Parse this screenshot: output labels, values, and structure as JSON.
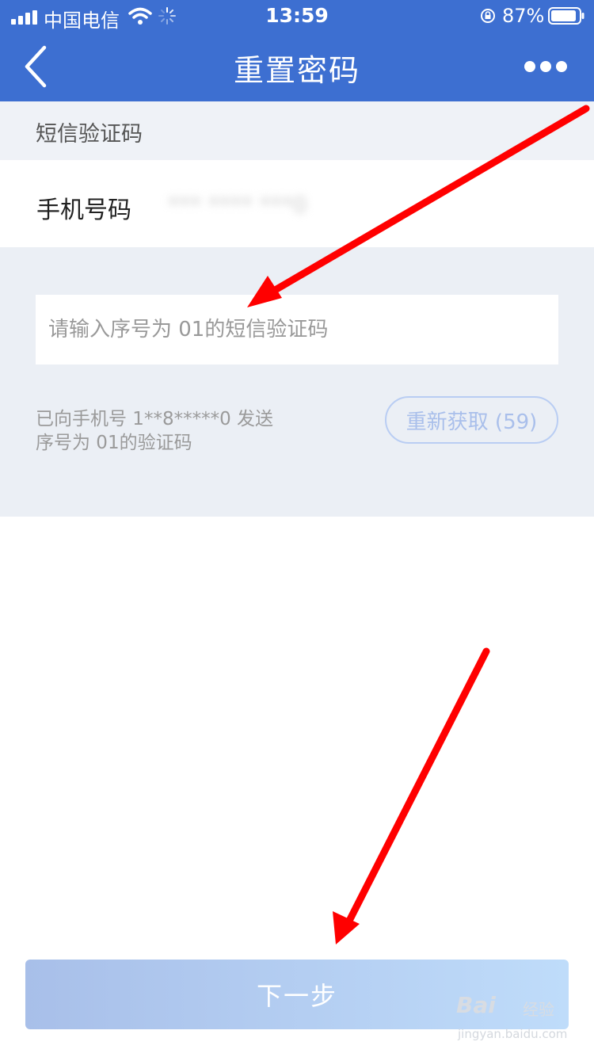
{
  "status_bar": {
    "carrier": "中国电信",
    "time": "13:59",
    "battery": "87%"
  },
  "nav": {
    "title": "重置密码",
    "back_icon": "chevron-left-icon",
    "more_icon": "more-dots-icon"
  },
  "sms_section": {
    "header": "短信验证码",
    "phone_label": "手机号码",
    "phone_value": "*** **** ***0",
    "code_placeholder": "请输入序号为 01的短信验证码",
    "code_value": "",
    "sent_info": "已向手机号 1**8*****0 发送序号为 01的验证码",
    "resend_label": "重新获取 (59)"
  },
  "footer": {
    "next_label": "下一步"
  },
  "watermark": {
    "brand": "Bai",
    "brand_cn": "经验",
    "url": "jingyan.baidu.com"
  },
  "colors": {
    "primary": "#3d6fd1",
    "annotation_arrow": "#ff0000",
    "section_bg": "#ebeff5"
  }
}
